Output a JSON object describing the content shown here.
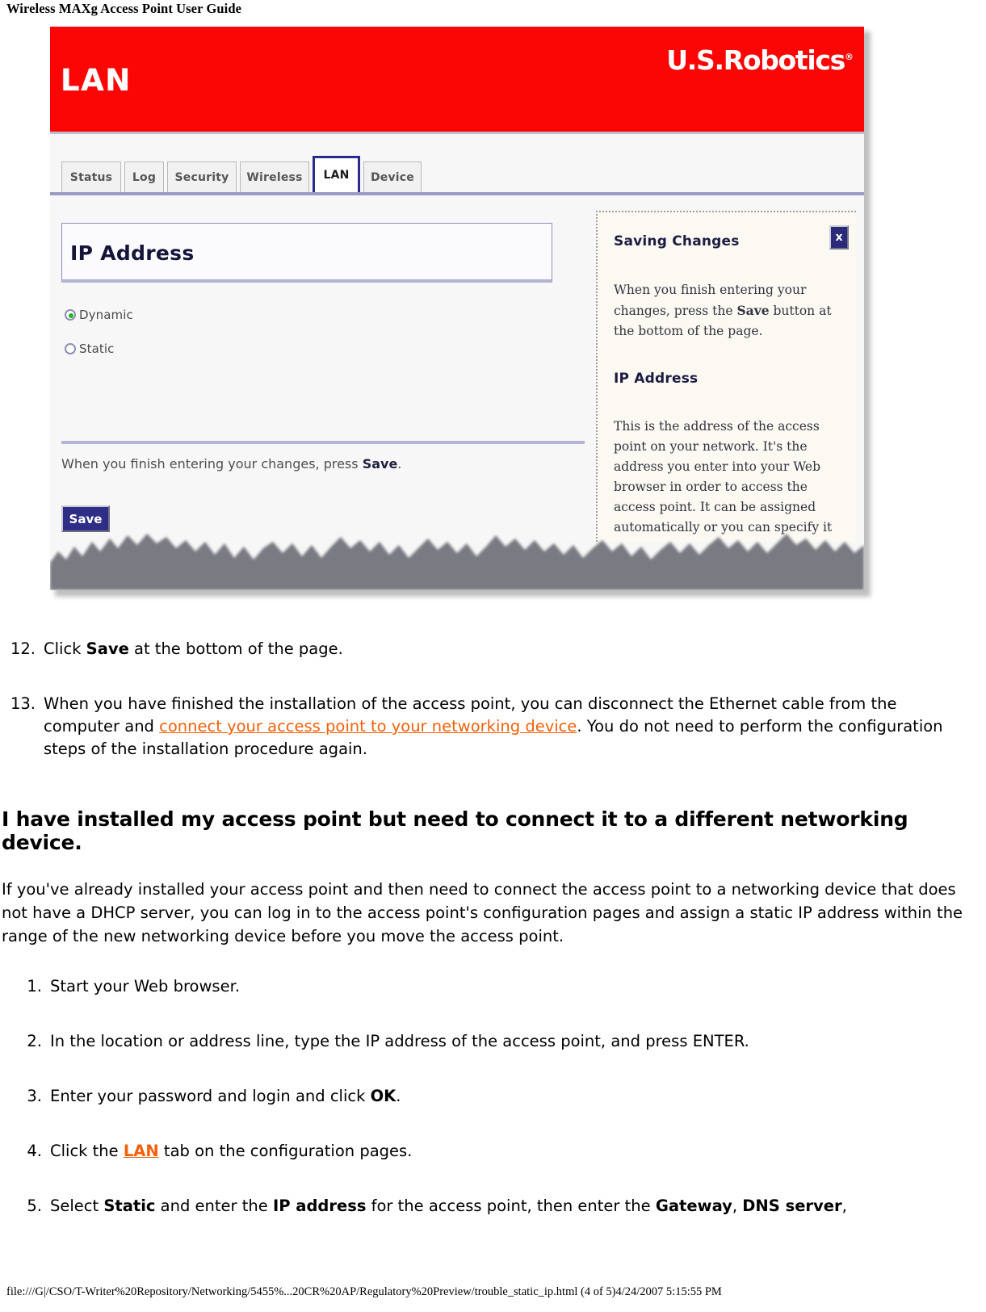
{
  "page_header": "Wireless MAXg Access Point User Guide",
  "figure": {
    "banner": {
      "title": "LAN",
      "logo": "U.S.Robotics",
      "logo_mark": "®",
      "color": "#fb0505"
    },
    "tabs": [
      {
        "label": "Status",
        "active": false
      },
      {
        "label": "Log",
        "active": false
      },
      {
        "label": "Security",
        "active": false
      },
      {
        "label": "Wireless",
        "active": false
      },
      {
        "label": "LAN",
        "active": true
      },
      {
        "label": "Device",
        "active": false
      }
    ],
    "config": {
      "section_title": "IP Address",
      "radios": [
        {
          "label": "Dynamic",
          "selected": true
        },
        {
          "label": "Static",
          "selected": false
        }
      ],
      "save_note_pre": "When you finish entering your changes, press ",
      "save_note_bold": "Save",
      "save_note_post": ".",
      "save_button": "Save"
    },
    "help": {
      "close_label": "x",
      "heading_1": "Saving Changes",
      "body_1_pre": "When you finish entering your changes, press the ",
      "body_1_bold": "Save",
      "body_1_post": " button at the bottom of the page.",
      "heading_2": "IP Address",
      "body_2": "This is the address of the access point on your network. It's the address you enter into your Web browser in order to access the access point. It can be assigned automatically or you can specify it"
    }
  },
  "steps_upper": [
    {
      "num": "12.",
      "parts": [
        {
          "t": "Click ",
          "style": "normal"
        },
        {
          "t": "Save",
          "style": "bold"
        },
        {
          "t": " at the bottom of the page.",
          "style": "normal"
        }
      ]
    },
    {
      "num": "13.",
      "parts": [
        {
          "t": "When you have finished the installation of the access point, you can disconnect the Ethernet cable from the computer and ",
          "style": "normal"
        },
        {
          "t": "connect your access point to your networking device",
          "style": "link"
        },
        {
          "t": ". You do not need to perform the configuration steps of the installation procedure again.",
          "style": "normal"
        }
      ]
    }
  ],
  "question_heading": "I have installed my access point but need to connect it to a different networking device.",
  "intro_paragraph": "If you've already installed your access point and then need to connect the access point to a networking device that does not have a DHCP server, you can log in to the access point's configuration pages and assign a static IP address within the range of the new networking device before you move the access point.",
  "steps_lower": [
    {
      "num": "1.",
      "parts": [
        {
          "t": "Start your Web browser.",
          "style": "normal"
        }
      ]
    },
    {
      "num": "2.",
      "parts": [
        {
          "t": "In the location or address line, type the IP address of the access point, and press ENTER.",
          "style": "normal"
        }
      ]
    },
    {
      "num": "3.",
      "parts": [
        {
          "t": "Enter your password and login and click ",
          "style": "normal"
        },
        {
          "t": "OK",
          "style": "bold"
        },
        {
          "t": ".",
          "style": "normal"
        }
      ]
    },
    {
      "num": "4.",
      "parts": [
        {
          "t": "Click the ",
          "style": "normal"
        },
        {
          "t": "LAN",
          "style": "link-bold"
        },
        {
          "t": " tab on the configuration pages.",
          "style": "normal"
        }
      ]
    },
    {
      "num": "5.",
      "parts": [
        {
          "t": "Select ",
          "style": "normal"
        },
        {
          "t": "Static",
          "style": "bold"
        },
        {
          "t": " and enter the ",
          "style": "normal"
        },
        {
          "t": "IP address",
          "style": "bold"
        },
        {
          "t": " for the access point, then enter the ",
          "style": "normal"
        },
        {
          "t": "Gateway",
          "style": "bold"
        },
        {
          "t": ", ",
          "style": "normal"
        },
        {
          "t": "DNS server",
          "style": "bold"
        },
        {
          "t": ",",
          "style": "normal"
        }
      ]
    }
  ],
  "footer": "file:///G|/CSO/T-Writer%20Repository/Networking/5455%...20CR%20AP/Regulatory%20Preview/trouble_static_ip.html (4 of 5)4/24/2007 5:15:55 PM",
  "colors": {
    "banner_red": "#fb0505",
    "link_orange": "#f4600a",
    "tab_active_border": "#2b2b8f",
    "save_button": "#2e2e86",
    "radio_on": "#1fb81f"
  }
}
